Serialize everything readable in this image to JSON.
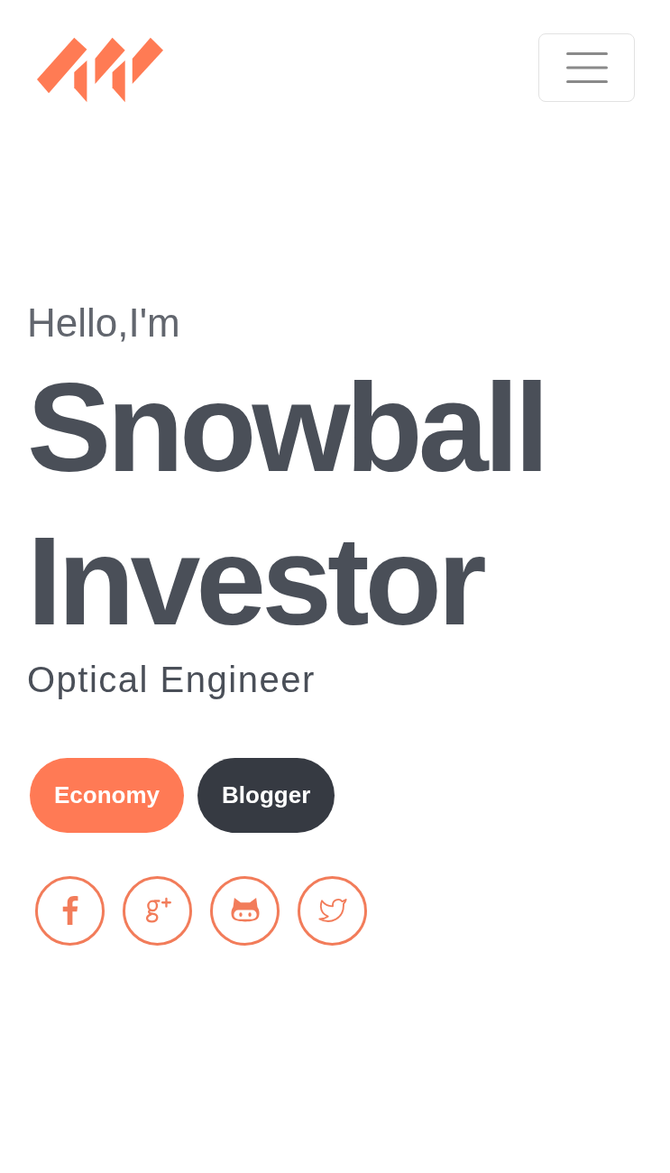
{
  "intro": {
    "greeting": "Hello,I'm",
    "name": "Snowball Investor",
    "role": "Optical Engineer"
  },
  "tags": [
    {
      "label": "Economy",
      "color": "#ff7a55"
    },
    {
      "label": "Blogger",
      "color": "#363a42"
    }
  ],
  "social_links": [
    {
      "kind": "facebook"
    },
    {
      "kind": "google_plus"
    },
    {
      "kind": "github"
    },
    {
      "kind": "twitter"
    }
  ]
}
